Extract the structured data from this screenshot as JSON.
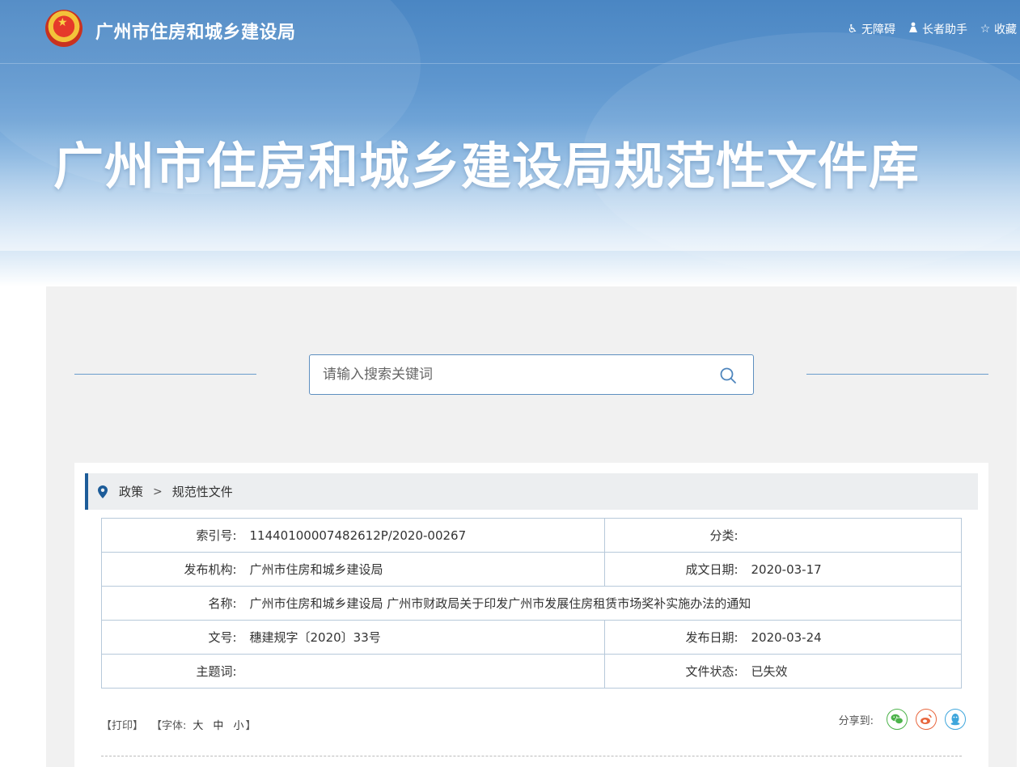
{
  "header": {
    "site_title": "广州市住房和城乡建设局",
    "hero_title": "广州市住房和城乡建设局规范性文件库",
    "links": [
      {
        "label": "无障碍",
        "icon": "wheelchair-icon"
      },
      {
        "label": "长者助手",
        "icon": "elder-icon"
      },
      {
        "label": "收藏",
        "icon": "star-icon"
      }
    ]
  },
  "search": {
    "placeholder": "请输入搜索关键词",
    "value": ""
  },
  "breadcrumb": {
    "items": [
      "政策",
      "规范性文件"
    ]
  },
  "info": {
    "index_label": "索引号:",
    "index_value": "11440100007482612P/2020-00267",
    "category_label": "分类:",
    "category_value": "",
    "publisher_label": "发布机构:",
    "publisher_value": "广州市住房和城乡建设局",
    "created_label": "成文日期:",
    "created_value": "2020-03-17",
    "name_label": "名称:",
    "name_value": "广州市住房和城乡建设局 广州市财政局关于印发广州市发展住房租赁市场奖补实施办法的通知",
    "docno_label": "文号:",
    "docno_value": "穗建规字〔2020〕33号",
    "pubdate_label": "发布日期:",
    "pubdate_value": "2020-03-24",
    "keywords_label": "主题词:",
    "keywords_value": "",
    "status_label": "文件状态:",
    "status_value": "已失效"
  },
  "tools": {
    "print": "【打印】",
    "font_prefix": "【字体:",
    "font_large": "大",
    "font_medium": "中",
    "font_small": "小",
    "font_suffix": "】"
  },
  "share": {
    "label": "分享到:",
    "targets": [
      "wechat-icon",
      "weibo-icon",
      "qq-icon"
    ]
  },
  "colors": {
    "accent": "#1d5c99",
    "banner_blue": "#4a86c3",
    "border": "#b7c9da"
  }
}
